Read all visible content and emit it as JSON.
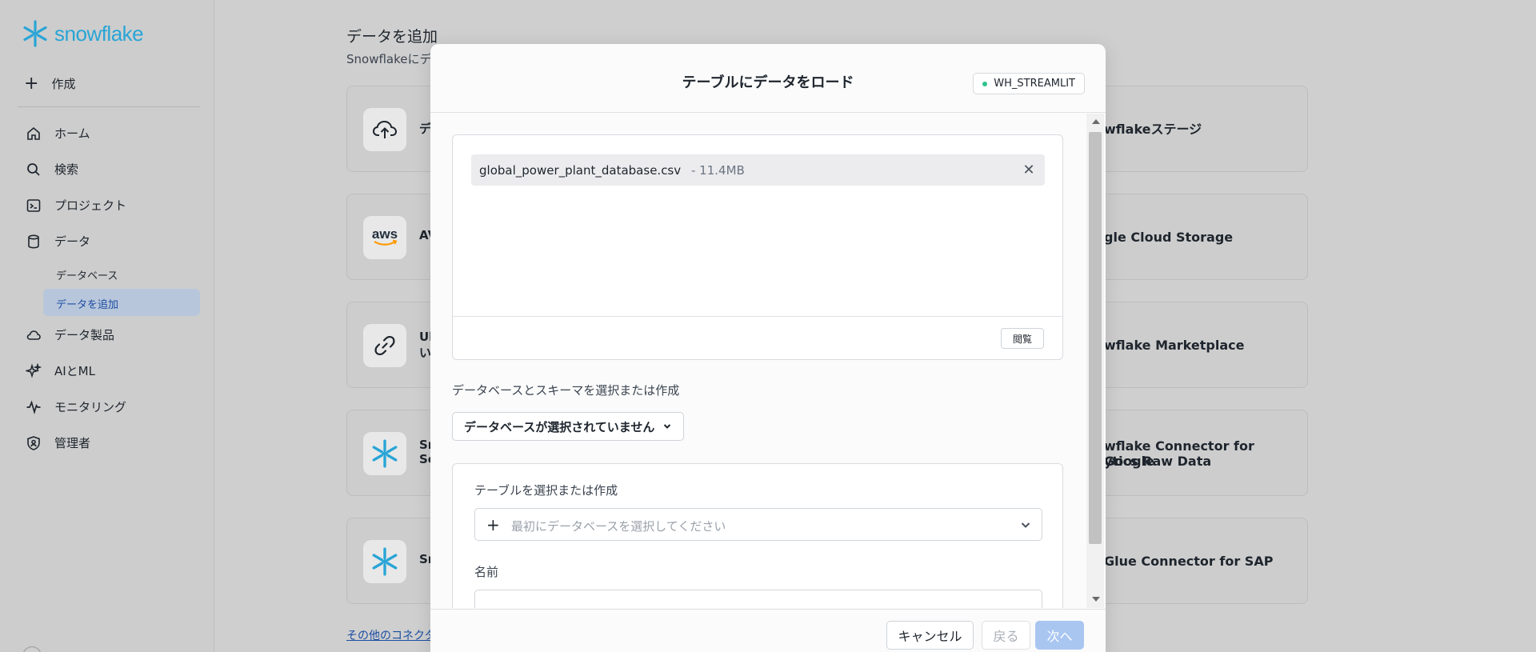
{
  "sidebar": {
    "logo_text": "snowflake",
    "create_label": "作成",
    "items": [
      {
        "label": "ホーム",
        "icon": "home-icon"
      },
      {
        "label": "検索",
        "icon": "search-icon"
      },
      {
        "label": "プロジェクト",
        "icon": "terminal-icon"
      },
      {
        "label": "データ",
        "icon": "database-icon"
      },
      {
        "label": "データ製品",
        "icon": "cloud-icon"
      },
      {
        "label": "AIとML",
        "icon": "sparkle-icon"
      },
      {
        "label": "モニタリング",
        "icon": "activity-icon"
      },
      {
        "label": "管理者",
        "icon": "shield-icon"
      }
    ],
    "sub_items": [
      {
        "label": "データベース"
      },
      {
        "label": "データを追加"
      }
    ]
  },
  "main": {
    "title": "データを追加",
    "subtitle": "Snowflakeにデ",
    "cards_left": [
      {
        "text": "デ",
        "icon": "upload-cloud-icon"
      },
      {
        "text": "AV",
        "icon": "aws-logo-icon"
      },
      {
        "text": "Ul",
        "text2": "い",
        "icon": "link-icon"
      },
      {
        "text": "Sr",
        "text2": "Sc",
        "icon": "snowflake-icon"
      },
      {
        "text": "Sr",
        "icon": "snowflake-icon"
      }
    ],
    "cards_right": [
      {
        "text": "wflakeステージ"
      },
      {
        "text": "gle Cloud Storage"
      },
      {
        "text": "wflake Marketplace"
      },
      {
        "text": "wflake Connector for Google",
        "text2": "ytics Raw Data"
      },
      {
        "text": "Glue Connector for SAP"
      }
    ],
    "more_link": "その他のコネクタ"
  },
  "modal": {
    "title": "テーブルにデータをロード",
    "warehouse": "WH_STREAMLIT",
    "file": {
      "name": "global_power_plant_database.csv",
      "size": "- 11.4MB"
    },
    "browse_label": "閲覧",
    "db_section_label": "データベースとスキーマを選択または作成",
    "db_select_label": "データベースが選択されていません",
    "table_label": "テーブルを選択または作成",
    "table_placeholder": "最初にデータベースを選択してください",
    "name_label": "名前",
    "name_value": "",
    "buttons": {
      "cancel": "キャンセル",
      "back": "戻る",
      "next": "次へ"
    }
  },
  "colors": {
    "brand": "#29a5d6",
    "active_nav_bg": "#b8c6db",
    "active_nav_text": "#1b4da1",
    "status_dot": "#2ec28b",
    "next_button_disabled": "#a9c6f1"
  }
}
